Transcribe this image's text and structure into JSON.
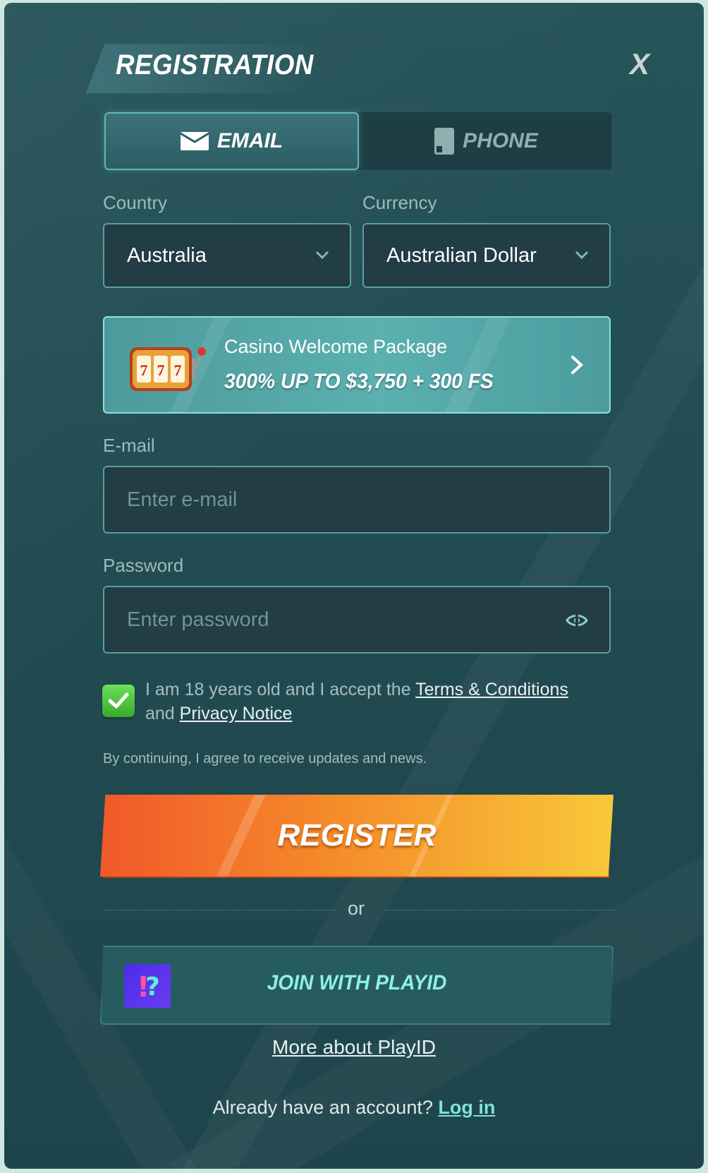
{
  "modal": {
    "title": "REGISTRATION",
    "close_label": "X"
  },
  "tabs": [
    {
      "label": "EMAIL",
      "icon": "envelope-icon",
      "active": true
    },
    {
      "label": "PHONE",
      "icon": "phone-icon",
      "active": false
    }
  ],
  "country": {
    "label": "Country",
    "value": "Australia"
  },
  "currency": {
    "label": "Currency",
    "value": "Australian Dollar"
  },
  "promo": {
    "label": "Casino Welcome Package",
    "value": "300% UP TO $3,750 + 300 FS",
    "icon": "slot-machine-icon"
  },
  "email": {
    "label": "E-mail",
    "placeholder": "Enter e-mail"
  },
  "password": {
    "label": "Password",
    "placeholder": "Enter password"
  },
  "consent": {
    "checked": true,
    "prefix": "I am 18 years old and I accept the",
    "terms_link": "Terms & Conditions",
    "middle": "and",
    "privacy_link": "Privacy Notice"
  },
  "updates_text": "By continuing, I agree to receive updates and news.",
  "register_label": "REGISTER",
  "or_text": "or",
  "playid": {
    "label": "JOIN WITH PLAYID",
    "icon": "playid-logo-icon"
  },
  "more_link": "More about PlayID",
  "login_prompt": {
    "text": "Already have an account?",
    "link": "Log in"
  },
  "colors": {
    "accent_teal": "#5fb7b8",
    "register_orange": "#f58b2a",
    "checkbox_green": "#3aa82c",
    "login_link": "#7fe3d6"
  }
}
